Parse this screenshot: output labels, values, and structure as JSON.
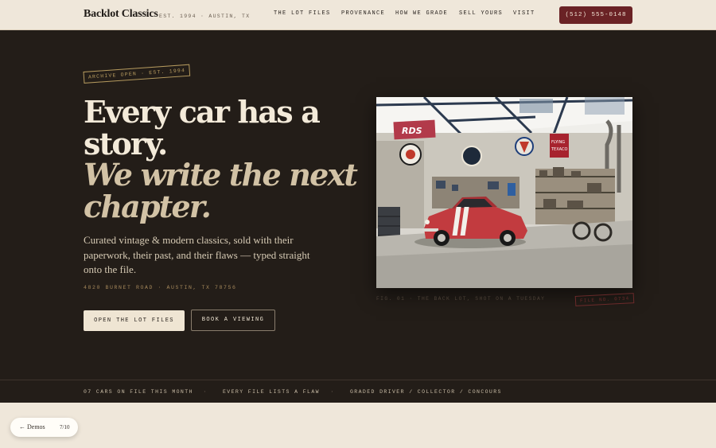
{
  "header": {
    "brand": "Backlot Classics",
    "brand_sub": "EST. 1994 · AUSTIN, TX",
    "nav": [
      "THE LOT FILES",
      "PROVENANCE",
      "HOW WE GRADE",
      "SELL YOURS",
      "VISIT"
    ],
    "phone": "(512) 555-0148"
  },
  "hero": {
    "tag": "ARCHIVE OPEN · EST. 1994",
    "headline_line1": "Every car has a",
    "headline_line2": "story.",
    "headline_italic_line1": "We write the next",
    "headline_italic_line2": "chapter.",
    "lead": "Curated vintage & modern classics, sold with their paperwork, their past, and their flaws — typed straight onto the file.",
    "address": "4820 BURNET ROAD · AUSTIN, TX 78756",
    "primary_cta": "OPEN THE LOT FILES",
    "secondary_cta": "BOOK A VIEWING",
    "photo_caption": "FIG. 01 · THE BACK LOT, SHOT ON A TUESDAY",
    "file_stamp": "FILE NO. 0734",
    "photo_signs": [
      "RDS",
      "FLYING",
      "TEXACO"
    ]
  },
  "ticker": [
    "07 CARS ON FILE THIS MONTH",
    "EVERY FILE LISTS A FLAW",
    "GRADED DRIVER / COLLECTOR / CONCOURS"
  ],
  "demo": {
    "back": "← Demos",
    "count": "7/10"
  },
  "colors": {
    "dark_bg": "#231d18",
    "paper": "#efe7da",
    "accent_red": "#6a2225",
    "gold": "#b59a5e"
  }
}
